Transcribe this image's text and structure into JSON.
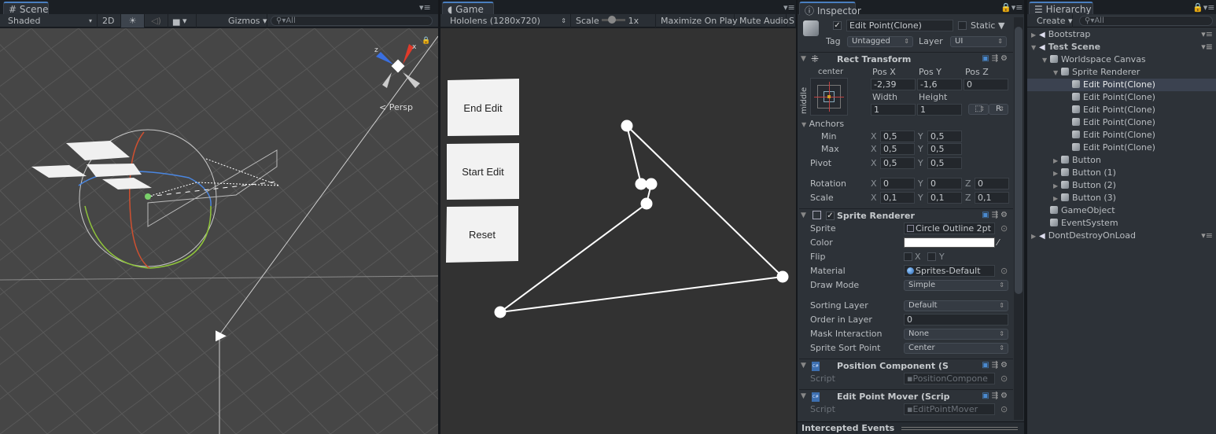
{
  "scene": {
    "tab": "Scene",
    "shading": "Shaded",
    "mode_2d": "2D",
    "gizmos": "Gizmos",
    "search_placeholder": "All",
    "persp": "Persp",
    "axis_x": "x",
    "axis_z": "z",
    "canvas_buttons": [
      "End Edit",
      "Start Edit",
      "Reset"
    ]
  },
  "game": {
    "tab": "Game",
    "resolution": "Hololens (1280x720)",
    "scale_label": "Scale",
    "scale_value": "1x",
    "maximize": "Maximize On Play",
    "mute": "Mute Audio",
    "stats": "S",
    "buttons": [
      "End Edit",
      "Start Edit",
      "Reset"
    ],
    "line_color": "#ffffff"
  },
  "inspector": {
    "tab": "Inspector",
    "object_name": "Edit Point(Clone)",
    "active": true,
    "static_label": "Static",
    "tag_label": "Tag",
    "tag_value": "Untagged",
    "layer_label": "Layer",
    "layer_value": "UI",
    "rect": {
      "title": "Rect Transform",
      "anchor_h": "center",
      "anchor_v": "middle",
      "posx_label": "Pos X",
      "posy_label": "Pos Y",
      "posz_label": "Pos Z",
      "posx": "-2,39",
      "posy": "-1,6",
      "posz": "0",
      "width_label": "Width",
      "height_label": "Height",
      "width": "1",
      "height": "1",
      "r_button": "R",
      "anchors": "Anchors",
      "min": "Min",
      "max": "Max",
      "pivot": "Pivot",
      "min_x": "0,5",
      "min_y": "0,5",
      "max_x": "0,5",
      "max_y": "0,5",
      "pivot_x": "0,5",
      "pivot_y": "0,5",
      "rotation": "Rotation",
      "rot_x": "0",
      "rot_y": "0",
      "rot_z": "0",
      "scale": "Scale",
      "scale_x": "0,1",
      "scale_y": "0,1",
      "scale_z": "0,1",
      "x": "X",
      "y": "Y",
      "z": "Z"
    },
    "sprite": {
      "title": "Sprite Renderer",
      "enabled": true,
      "sprite_label": "Sprite",
      "sprite_value": "Circle Outline 2pt",
      "color_label": "Color",
      "color_value": "#ffffff",
      "flip_label": "Flip",
      "flip_x": "X",
      "flip_y": "Y",
      "material_label": "Material",
      "material_value": "Sprites-Default",
      "drawmode_label": "Draw Mode",
      "drawmode_value": "Simple",
      "sorting_label": "Sorting Layer",
      "sorting_value": "Default",
      "order_label": "Order in Layer",
      "order_value": "0",
      "mask_label": "Mask Interaction",
      "mask_value": "None",
      "sortpoint_label": "Sprite Sort Point",
      "sortpoint_value": "Center"
    },
    "position_component": {
      "title": "Position Component (S",
      "script_label": "Script",
      "script_value": "PositionCompone"
    },
    "edit_point_mover": {
      "title": "Edit Point Mover (Scrip",
      "script_label": "Script",
      "script_value": "EditPointMover"
    },
    "intercepted": "Intercepted Events"
  },
  "hierarchy": {
    "tab": "Hierarchy",
    "create": "Create",
    "search_placeholder": "All",
    "items": [
      {
        "label": "Bootstrap",
        "depth": 0,
        "type": "scene",
        "arrow": "collapsed"
      },
      {
        "label": "Test Scene",
        "depth": 0,
        "type": "scene",
        "arrow": "expanded",
        "bold": true
      },
      {
        "label": "Worldspace Canvas",
        "depth": 1,
        "type": "object",
        "arrow": "expanded"
      },
      {
        "label": "Sprite Renderer",
        "depth": 2,
        "type": "object",
        "arrow": "expanded"
      },
      {
        "label": "Edit Point(Clone)",
        "depth": 3,
        "type": "object",
        "selected": true
      },
      {
        "label": "Edit Point(Clone)",
        "depth": 3,
        "type": "object"
      },
      {
        "label": "Edit Point(Clone)",
        "depth": 3,
        "type": "object"
      },
      {
        "label": "Edit Point(Clone)",
        "depth": 3,
        "type": "object"
      },
      {
        "label": "Edit Point(Clone)",
        "depth": 3,
        "type": "object"
      },
      {
        "label": "Edit Point(Clone)",
        "depth": 3,
        "type": "object"
      },
      {
        "label": "Button",
        "depth": 2,
        "type": "object",
        "arrow": "collapsed"
      },
      {
        "label": "Button (1)",
        "depth": 2,
        "type": "object",
        "arrow": "collapsed"
      },
      {
        "label": "Button (2)",
        "depth": 2,
        "type": "object",
        "arrow": "collapsed"
      },
      {
        "label": "Button (3)",
        "depth": 2,
        "type": "object",
        "arrow": "collapsed"
      },
      {
        "label": "GameObject",
        "depth": 1,
        "type": "object"
      },
      {
        "label": "EventSystem",
        "depth": 1,
        "type": "object"
      },
      {
        "label": "DontDestroyOnLoad",
        "depth": 0,
        "type": "scene",
        "arrow": "collapsed"
      }
    ]
  }
}
